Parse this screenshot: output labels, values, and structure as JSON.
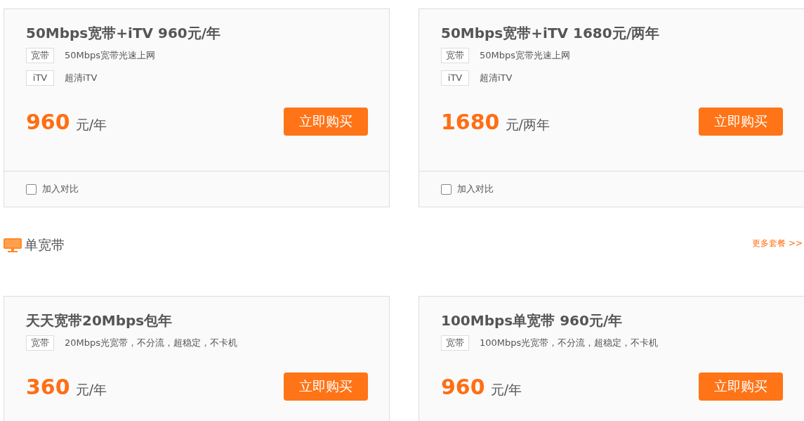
{
  "sections": [
    {
      "cards": [
        {
          "title": "50Mbps宽带+iTV 960元/年",
          "features": [
            {
              "tag": "宽带",
              "text": "50Mbps宽带光速上网"
            },
            {
              "tag": "iTV",
              "text": "超清iTV"
            }
          ],
          "price": "960",
          "unit": "元/年",
          "button": "立即购买",
          "compare": {
            "label": "加入对比",
            "checked": false
          }
        },
        {
          "title": "50Mbps宽带+iTV 1680元/两年",
          "features": [
            {
              "tag": "宽带",
              "text": "50Mbps宽带光速上网"
            },
            {
              "tag": "iTV",
              "text": "超清iTV"
            }
          ],
          "price": "1680",
          "unit": "元/两年",
          "button": "立即购买",
          "compare": {
            "label": "加入对比",
            "checked": false
          }
        }
      ]
    },
    {
      "title": "单宽带",
      "more_link": "更多套餐 >>",
      "cards": [
        {
          "title": "天天宽带20Mbps包年",
          "features": [
            {
              "tag": "宽带",
              "text": "20Mbps光宽带，不分流，超稳定，不卡机"
            }
          ],
          "price": "360",
          "unit": "元/年",
          "button": "立即购买"
        },
        {
          "title": "100Mbps单宽带 960元/年",
          "features": [
            {
              "tag": "宽带",
              "text": "100Mbps光宽带，不分流，超稳定，不卡机"
            }
          ],
          "price": "960",
          "unit": "元/年",
          "button": "立即购买"
        }
      ]
    }
  ]
}
